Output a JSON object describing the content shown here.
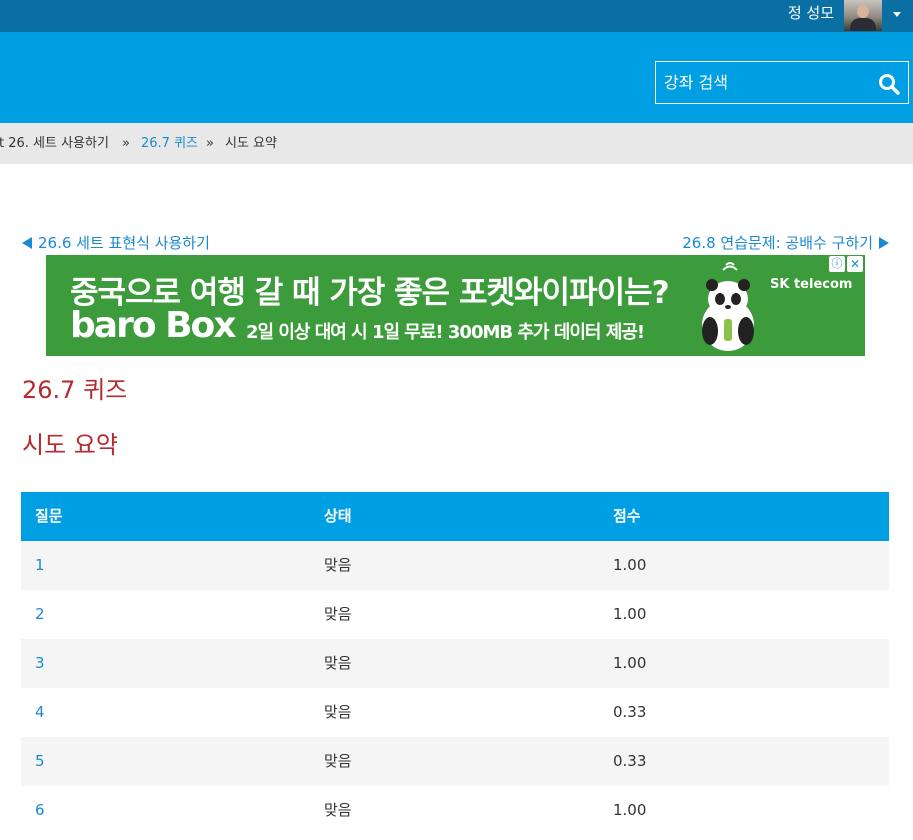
{
  "user": {
    "name": "정 성모"
  },
  "search": {
    "placeholder": "강좌 검색"
  },
  "breadcrumb": {
    "part": "t 26. 세트 사용하기",
    "sep": "»",
    "section": "26.7 퀴즈",
    "current": "시도 요약"
  },
  "nav": {
    "prev": "26.6 세트 표현식 사용하기",
    "next": "26.8 연습문제: 공배수 구하기"
  },
  "ad": {
    "headline": "중국으로 여행 갈 때 가장 좋은 포켓와이파이는?",
    "logo": "baro Box",
    "sub": "2일 이상 대여 시 1일 무료! 300MB 추가 데이터 제공!",
    "brand": "SK telecom",
    "info": "ⓘ",
    "close": "✕"
  },
  "page": {
    "title": "26.7 퀴즈",
    "subtitle": "시도 요약"
  },
  "table": {
    "headers": [
      "질문",
      "상태",
      "점수"
    ],
    "rows": [
      [
        "1",
        "맞음",
        "1.00"
      ],
      [
        "2",
        "맞음",
        "1.00"
      ],
      [
        "3",
        "맞음",
        "1.00"
      ],
      [
        "4",
        "맞음",
        "0.33"
      ],
      [
        "5",
        "맞음",
        "0.33"
      ],
      [
        "6",
        "맞음",
        "1.00"
      ]
    ]
  },
  "colors": {
    "topbar": "#0a6fa3",
    "header": "#009fe3",
    "link": "#1a8ad1",
    "heading": "#b5292f",
    "ad_bg": "#3c9b3a"
  }
}
